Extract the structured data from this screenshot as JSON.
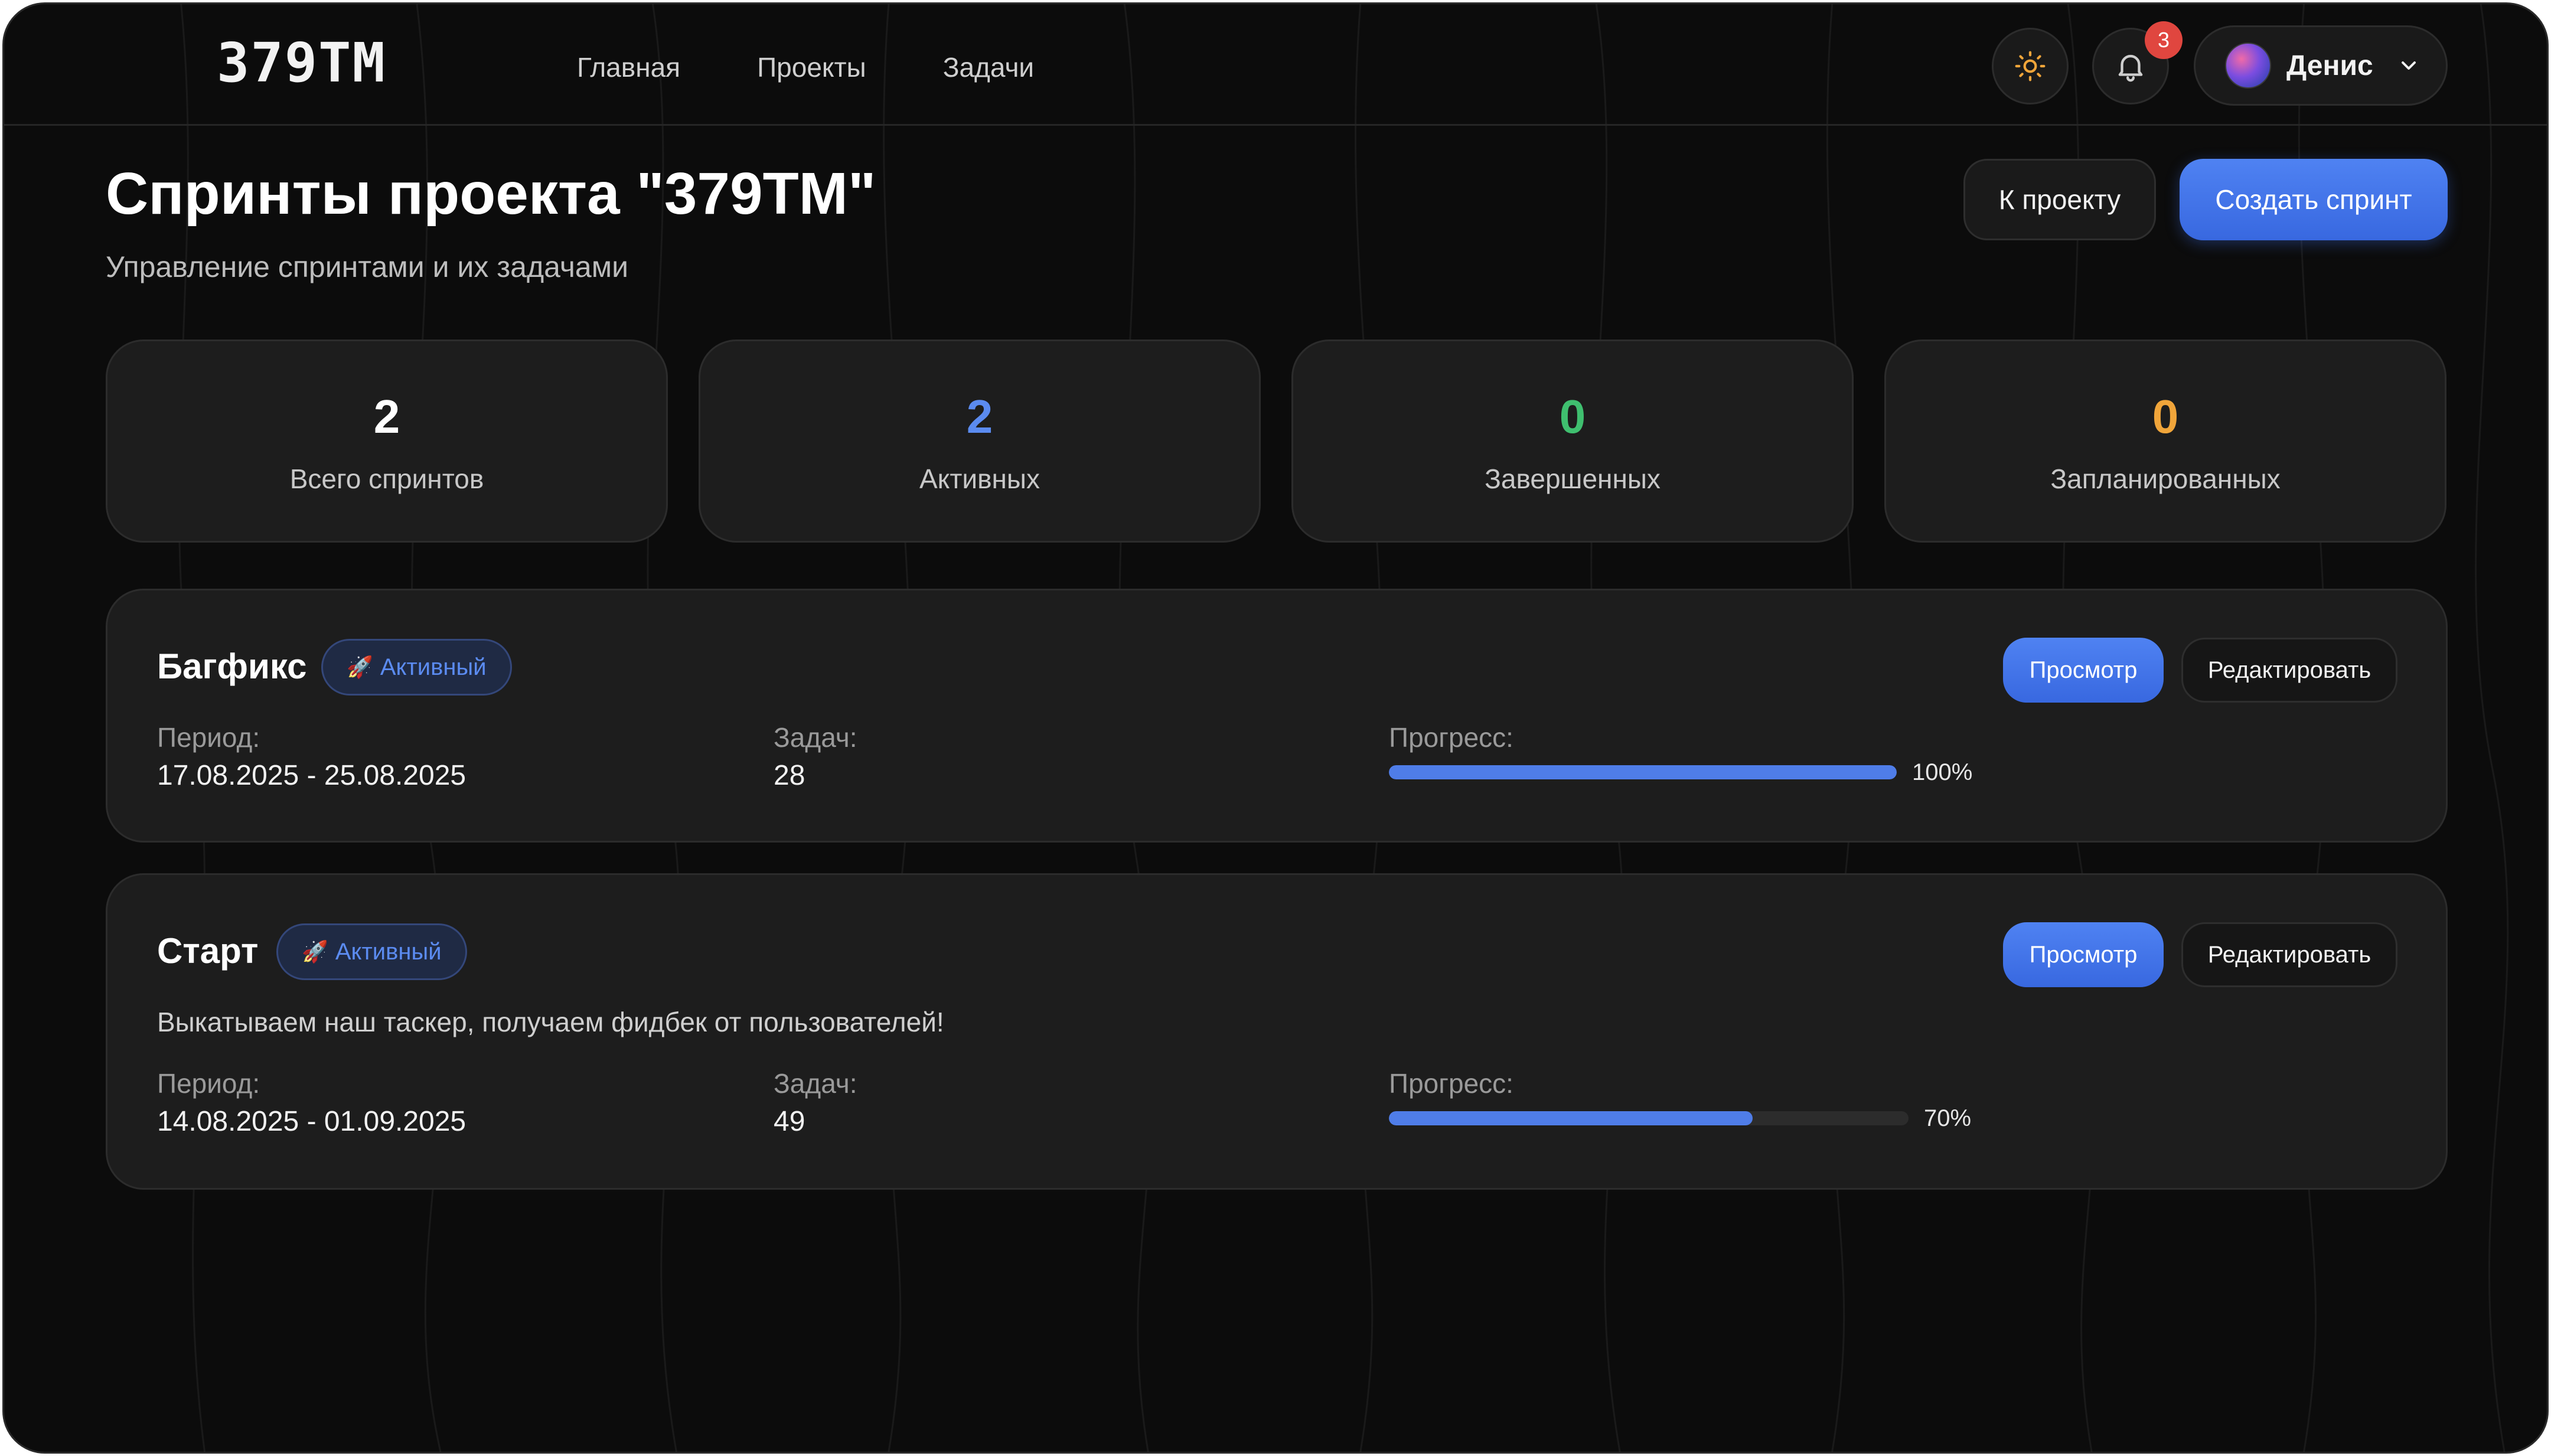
{
  "header": {
    "logo": "379TM",
    "nav": [
      "Главная",
      "Проекты",
      "Задачи"
    ],
    "notifications_count": "3",
    "user_name": "Денис"
  },
  "page": {
    "title": "Спринты проекта \"379TM\"",
    "subtitle": "Управление спринтами и их задачами",
    "back_label": "К проекту",
    "create_label": "Создать спринт"
  },
  "stats": [
    {
      "value": "2",
      "label": "Всего спринтов",
      "color": "#ffffff"
    },
    {
      "value": "2",
      "label": "Активных",
      "color": "#5b8bf0"
    },
    {
      "value": "0",
      "label": "Завершенных",
      "color": "#3fbf6f"
    },
    {
      "value": "0",
      "label": "Запланированных",
      "color": "#f0a53a"
    }
  ],
  "sprints": [
    {
      "name": "Багфикс",
      "status": "Активный",
      "view_label": "Просмотр",
      "edit_label": "Редактировать",
      "description": "",
      "period_label": "Период:",
      "period": "17.08.2025 - 25.08.2025",
      "tasks_label": "Задач:",
      "tasks": "28",
      "progress_label": "Прогресс:",
      "progress": 100,
      "progress_text": "100%"
    },
    {
      "name": "Старт",
      "status": "Активный",
      "view_label": "Просмотр",
      "edit_label": "Редактировать",
      "description": "Выкатываем наш таскер, получаем фидбек от пользователей!",
      "period_label": "Период:",
      "period": "14.08.2025 - 01.09.2025",
      "tasks_label": "Задач:",
      "tasks": "49",
      "progress_label": "Прогресс:",
      "progress": 70,
      "progress_text": "70%"
    }
  ],
  "colors": {
    "accent": "#4f7de8",
    "status_text": "#5b8bf0",
    "badge": "#e0463f",
    "sun": "#f0a53a"
  }
}
